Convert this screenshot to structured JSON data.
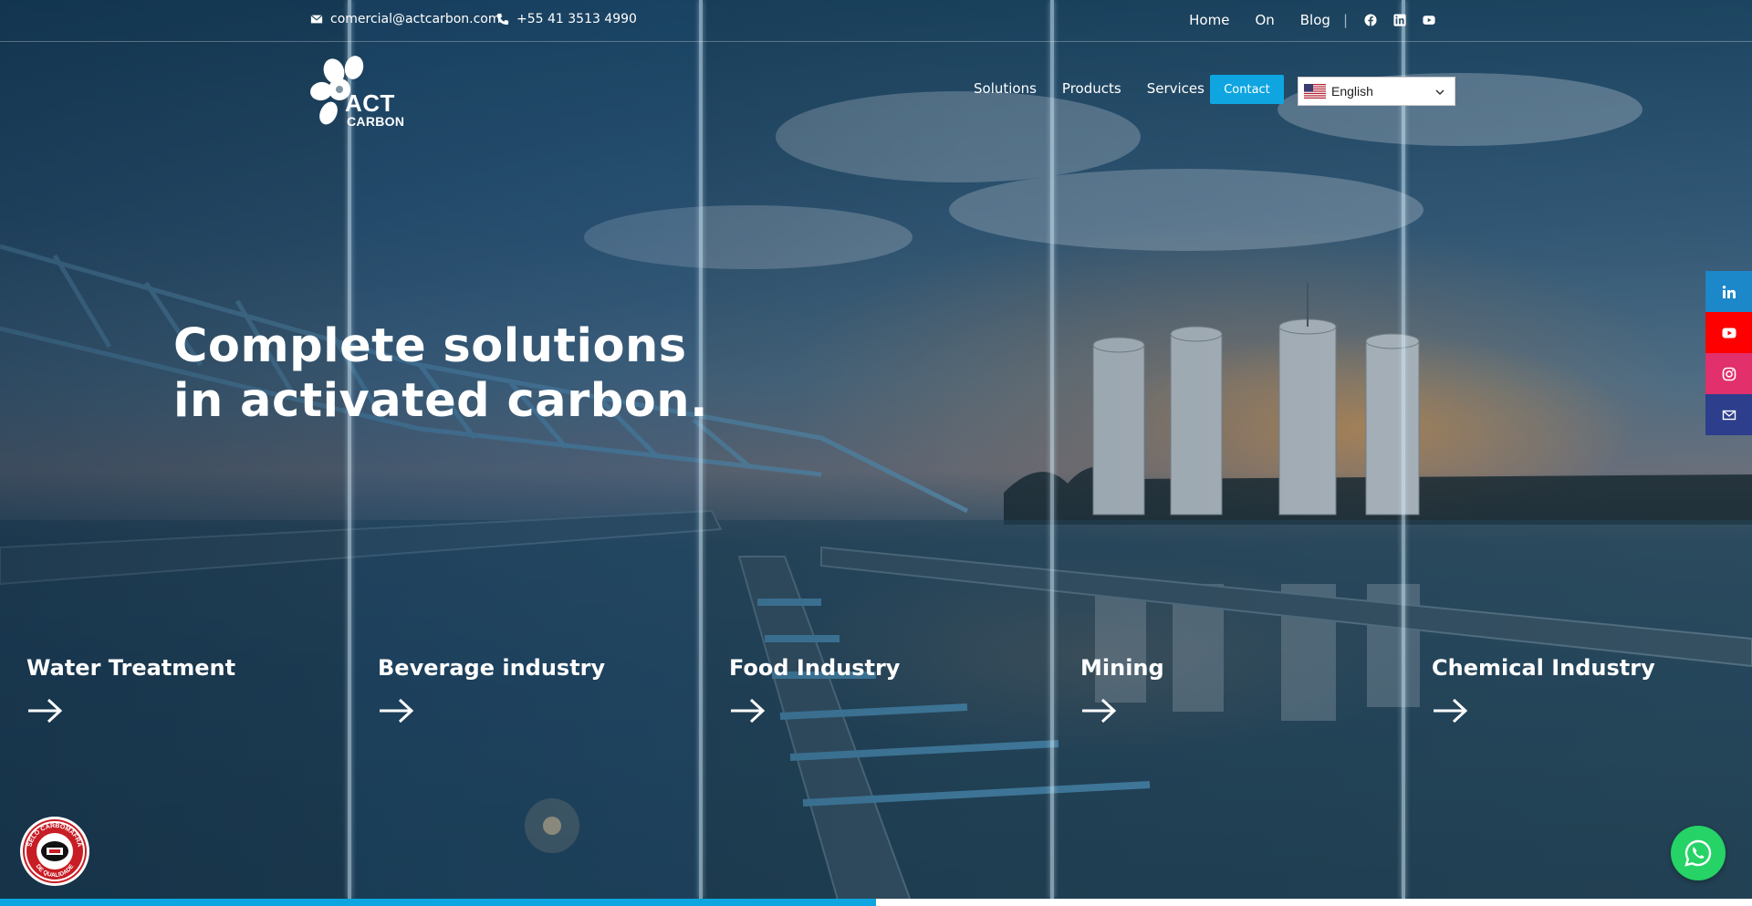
{
  "topbar": {
    "email": "comercial@actcarbon.com",
    "phone": "+55 41 3513 4990",
    "links": [
      "Home",
      "On",
      "Blog"
    ],
    "social_icons": [
      "facebook-icon",
      "linkedin-icon",
      "youtube-icon"
    ]
  },
  "header": {
    "logo_line1": "ACT",
    "logo_line2": "CARBON",
    "nav": [
      "Solutions",
      "Products",
      "Services"
    ],
    "contact_label": "Contact",
    "language": "English"
  },
  "hero": {
    "title_line1": "Complete solutions",
    "title_line2": "in activated carbon."
  },
  "industries": [
    {
      "name": "Water Treatment",
      "icon": "arrow-right-icon"
    },
    {
      "name": "Beverage industry",
      "icon": "arrow-right-icon"
    },
    {
      "name": "Food Industry",
      "icon": "arrow-right-icon"
    },
    {
      "name": "Mining",
      "icon": "arrow-right-icon"
    },
    {
      "name": "Chemical Industry",
      "icon": "arrow-right-icon"
    }
  ],
  "side_social": [
    {
      "icon": "linkedin-icon",
      "color": "#1c87c9"
    },
    {
      "icon": "youtube-icon",
      "color": "#ff0000"
    },
    {
      "icon": "instagram-icon",
      "color": "#e1306c"
    },
    {
      "icon": "mail-icon",
      "color": "#2c3e8c"
    }
  ],
  "seal": {
    "text_top": "SELO CARBOMAFRA",
    "text_bottom": "DE QUALIDADE"
  },
  "colors": {
    "accent": "#0ea5e0",
    "whatsapp": "#25d366"
  },
  "slider_progress": 0.5
}
